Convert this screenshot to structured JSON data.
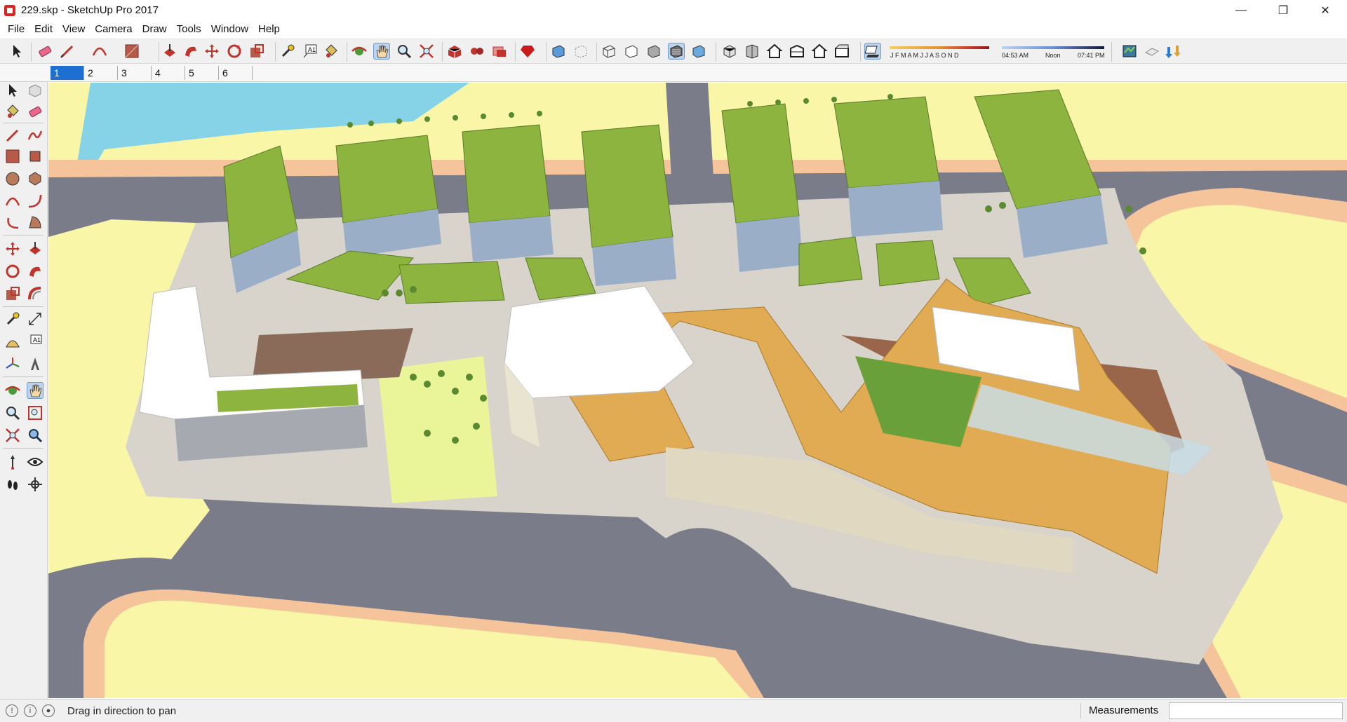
{
  "window": {
    "title": "229.skp - SketchUp Pro 2017",
    "controls": [
      "—",
      "❐",
      "✕"
    ]
  },
  "menu": [
    "File",
    "Edit",
    "View",
    "Camera",
    "Draw",
    "Tools",
    "Window",
    "Help"
  ],
  "shadow_settings": {
    "months": "J F M A M J J A S O N D",
    "time_start": "04:53 AM",
    "time_mid": "Noon",
    "time_end": "07:41 PM"
  },
  "scene_tabs": [
    "1",
    "2",
    "3",
    "4",
    "5",
    "6"
  ],
  "active_scene": "1",
  "toolbar_icons": [
    "select-icon",
    "eraser-icon",
    "line-icon",
    "arc-icon",
    "rectangle-icon",
    "push-pull-icon",
    "follow-me-icon",
    "move-icon",
    "rotate-icon",
    "scale-icon",
    "tape-measure-icon",
    "text-icon",
    "paint-bucket-icon",
    "orbit-icon",
    "pan-icon",
    "zoom-icon",
    "zoom-extents-icon",
    "warehouse-icon",
    "extension-warehouse-icon",
    "layout-icon",
    "ruby-icon",
    "xray-icon",
    "back-edges-icon",
    "wireframe-icon",
    "hidden-line-icon",
    "shaded-icon",
    "shaded-textures-icon",
    "monochrome-icon",
    "iso-view-icon",
    "top-view-icon",
    "front-view-icon",
    "right-view-icon",
    "back-view-icon",
    "left-view-icon",
    "shadows-toggle-icon",
    "geo-location-icon",
    "add-location-icon",
    "sandbox-icon"
  ],
  "left_tools": [
    "select-icon",
    "component-icon",
    "paint-bucket-icon",
    "eraser-icon",
    "line-icon",
    "freehand-icon",
    "rectangle-icon",
    "rotated-rectangle-icon",
    "circle-icon",
    "polygon-icon",
    "arc-icon",
    "two-point-arc-icon",
    "three-point-arc-icon",
    "pie-icon",
    "move-icon",
    "push-pull-icon",
    "rotate-icon",
    "follow-me-icon",
    "scale-icon",
    "offset-icon",
    "tape-measure-icon",
    "dimension-icon",
    "protractor-icon",
    "text-icon",
    "axes-icon",
    "3d-text-icon",
    "orbit-icon",
    "pan-icon",
    "zoom-icon",
    "zoom-window-icon",
    "zoom-extents-icon",
    "previous-view-icon",
    "position-camera-icon",
    "look-around-icon",
    "walk-icon",
    "section-plane-icon"
  ],
  "status": {
    "message": "Drag in direction to pan",
    "measurements_label": "Measurements",
    "measurements_value": ""
  },
  "colors": {
    "ground": "#f9f6a8",
    "road": "#7b7c8a",
    "sidewalk": "#f5c49a",
    "water": "#86d3e8",
    "roof_green": "#8db43f",
    "building_gold": "#e0ab52",
    "active_tab": "#1e6fd2"
  }
}
